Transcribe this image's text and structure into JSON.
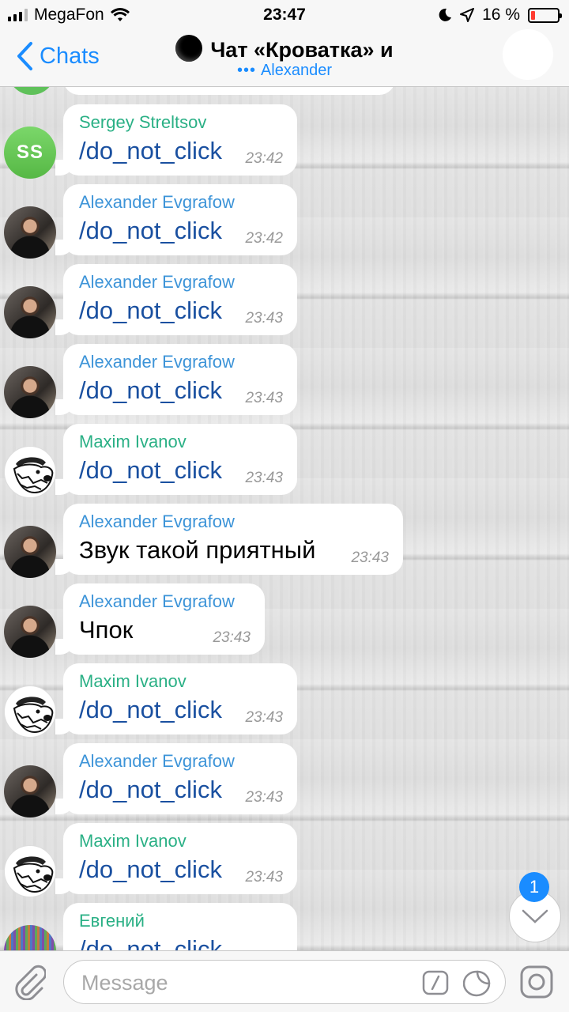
{
  "status": {
    "carrier": "MegaFon",
    "time": "23:47",
    "battery_percent": "16 %",
    "battery_level": 0.16
  },
  "nav": {
    "back_label": "Chats",
    "title": "Чат «Кроватка» и",
    "subtitle": "Alexander",
    "typing_indicator": "•••"
  },
  "messages": [
    {
      "sender": "Sergey Streltsov",
      "text": "/do_not_click",
      "time": "23:42",
      "avatar": "SS",
      "sender_color": "#2ab085",
      "is_command": true
    },
    {
      "sender": "Alexander Evgrafow",
      "text": "/do_not_click",
      "time": "23:42",
      "avatar": "photo",
      "sender_color": "#3d94d8",
      "is_command": true
    },
    {
      "sender": "Alexander Evgrafow",
      "text": "/do_not_click",
      "time": "23:43",
      "avatar": "photo",
      "sender_color": "#3d94d8",
      "is_command": true
    },
    {
      "sender": "Alexander Evgrafow",
      "text": "/do_not_click",
      "time": "23:43",
      "avatar": "photo",
      "sender_color": "#3d94d8",
      "is_command": true
    },
    {
      "sender": "Maxim Ivanov",
      "text": "/do_not_click",
      "time": "23:43",
      "avatar": "bear",
      "sender_color": "#2ab085",
      "is_command": true
    },
    {
      "sender": "Alexander Evgrafow",
      "text": "Звук такой приятный",
      "time": "23:43",
      "avatar": "photo",
      "sender_color": "#3d94d8",
      "is_command": false
    },
    {
      "sender": "Alexander Evgrafow",
      "text": "Чпок",
      "time": "23:43",
      "avatar": "photo",
      "sender_color": "#3d94d8",
      "is_command": false
    },
    {
      "sender": "Maxim Ivanov",
      "text": "/do_not_click",
      "time": "23:43",
      "avatar": "bear",
      "sender_color": "#2ab085",
      "is_command": true
    },
    {
      "sender": "Alexander Evgrafow",
      "text": "/do_not_click",
      "time": "23:43",
      "avatar": "photo",
      "sender_color": "#3d94d8",
      "is_command": true
    },
    {
      "sender": "Maxim Ivanov",
      "text": "/do_not_click",
      "time": "23:43",
      "avatar": "bear",
      "sender_color": "#2ab085",
      "is_command": true
    },
    {
      "sender": "Евгений",
      "text": "/do_not_click",
      "time": "",
      "avatar": "pixel",
      "sender_color": "#2ab085",
      "is_command": true
    }
  ],
  "scroll_badge": "1",
  "input": {
    "placeholder": "Message"
  },
  "colors": {
    "accent": "#1a8cff",
    "command_link": "#1a50a0",
    "battery_low": "#ff3b30"
  }
}
